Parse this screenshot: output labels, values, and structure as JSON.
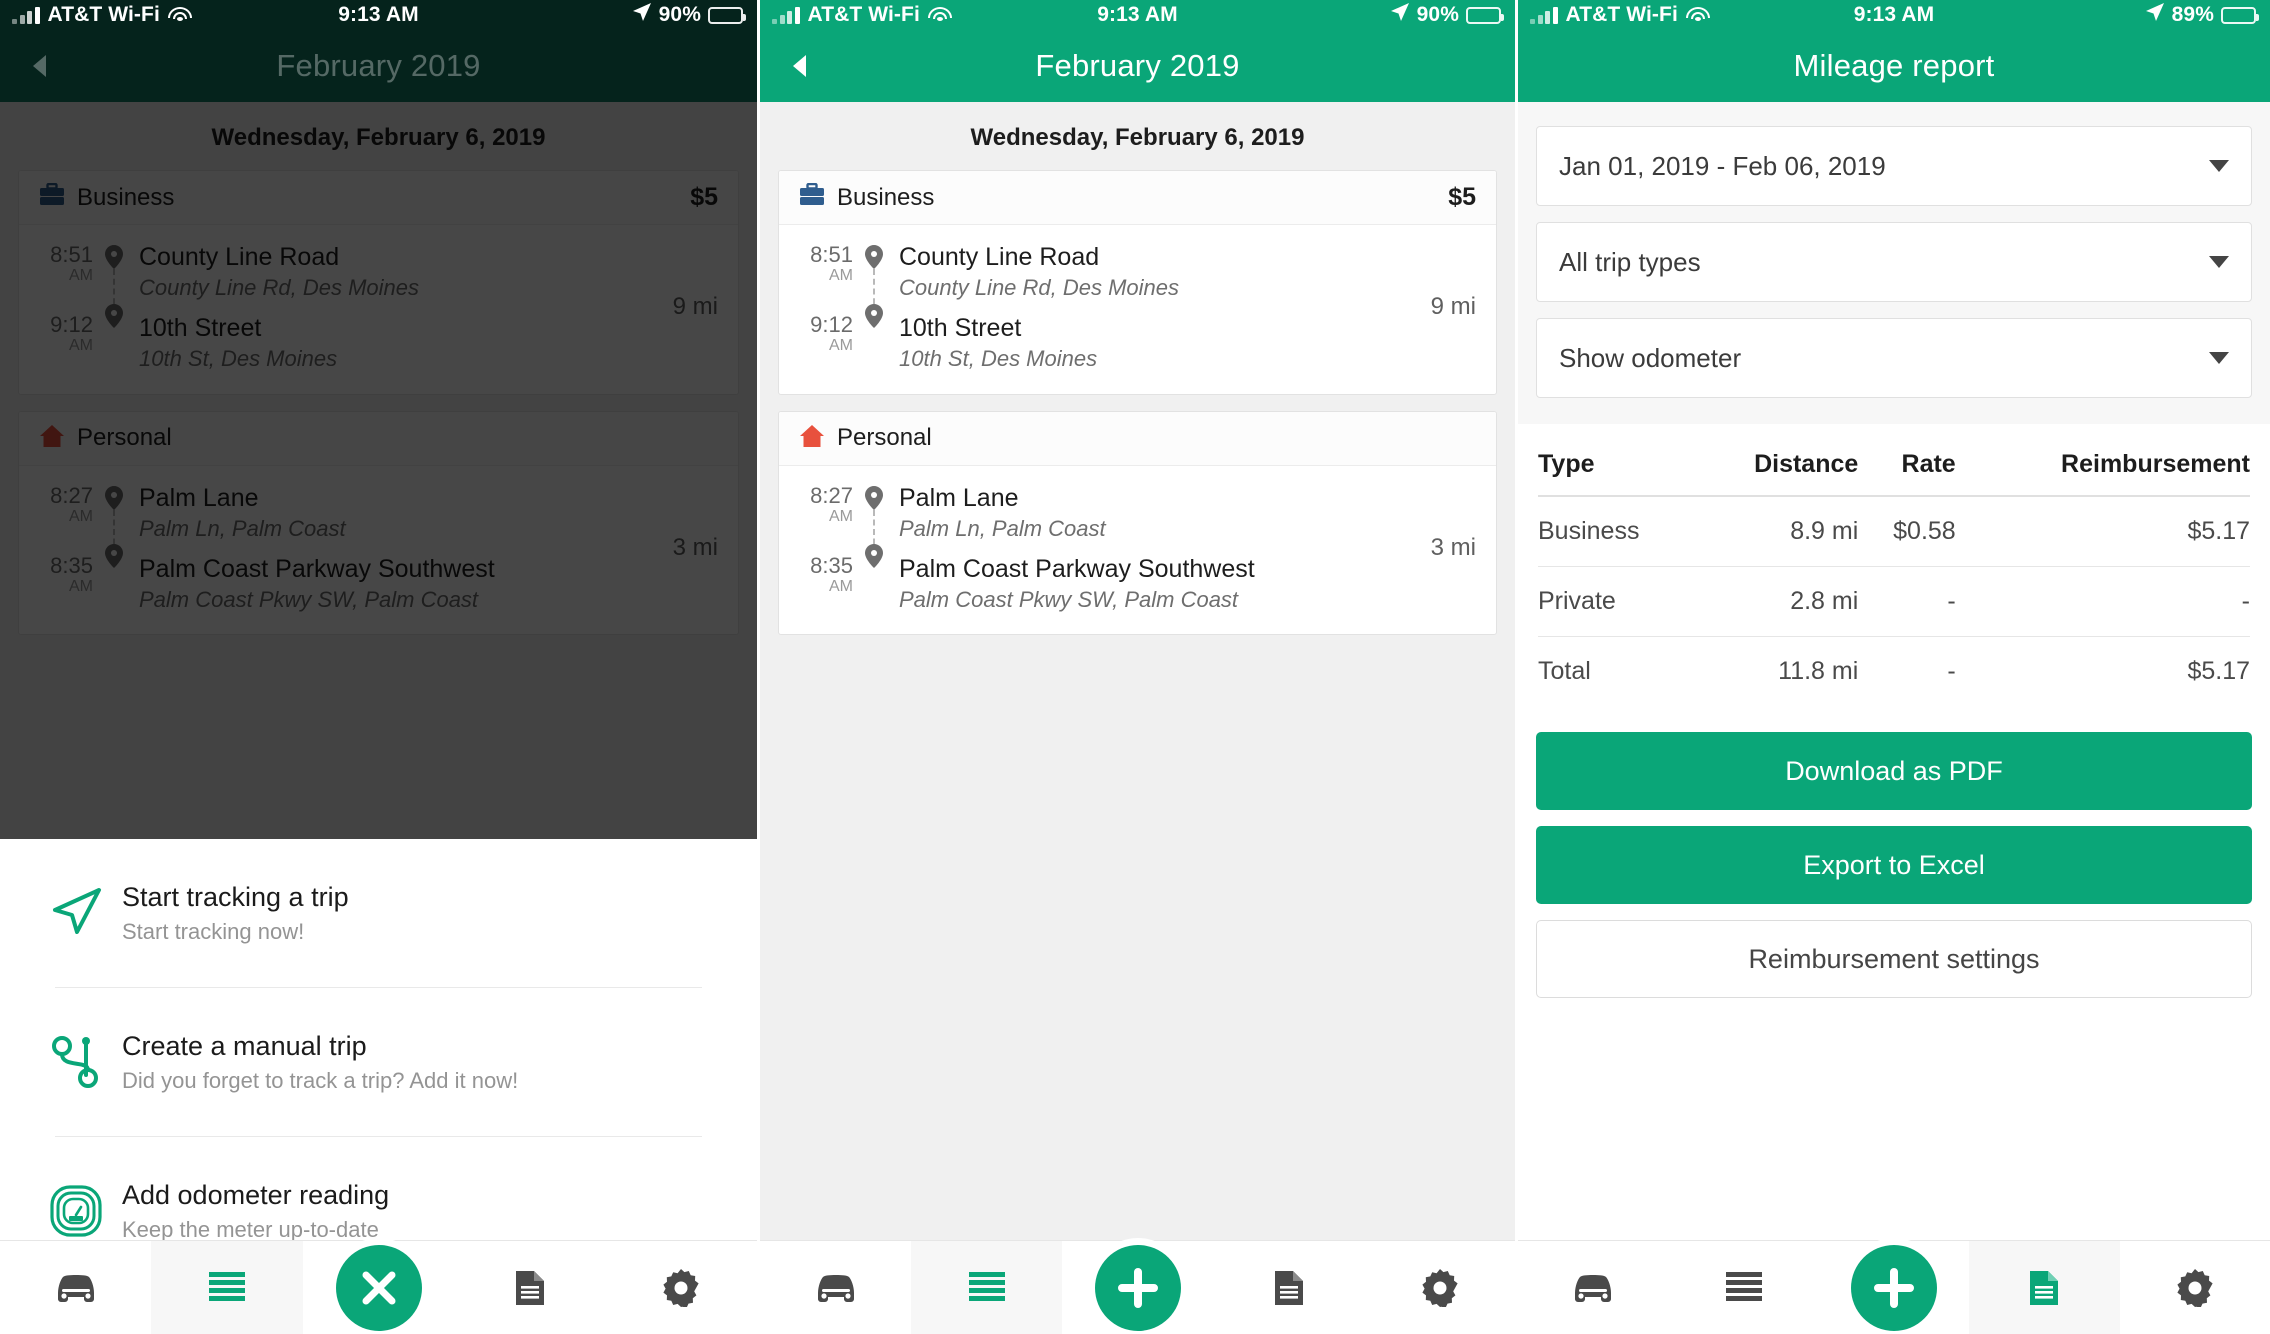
{
  "theme": {
    "brand": "#0aa678",
    "dim_overlay": "rgba(0,0,0,0.72)",
    "business_icon_color": "#2f5d8e",
    "personal_icon_color": "#e8513d"
  },
  "screens": [
    {
      "id": "trips-with-action-sheet",
      "status": {
        "carrier": "AT&T Wi-Fi",
        "time": "9:13 AM",
        "battery_pct": "90%"
      },
      "nav": {
        "title": "February 2019",
        "back": "back-arrow"
      },
      "day_label": "Wednesday, February 6, 2019",
      "cards": [
        {
          "category": "Business",
          "icon": "briefcase-icon",
          "amount": "$5",
          "distance": "9 mi",
          "legs": [
            {
              "time": "8:51",
              "ampm": "AM",
              "name": "County Line Road",
              "address": "County Line Rd, Des Moines"
            },
            {
              "time": "9:12",
              "ampm": "AM",
              "name": "10th Street",
              "address": "10th St, Des Moines"
            }
          ]
        },
        {
          "category": "Personal",
          "icon": "home-icon",
          "amount": "",
          "distance": "3 mi",
          "legs": [
            {
              "time": "8:27",
              "ampm": "AM",
              "name": "Palm Lane",
              "address": "Palm Ln, Palm Coast"
            },
            {
              "time": "8:35",
              "ampm": "AM",
              "name": "Palm Coast Parkway Southwest",
              "address": "Palm Coast Pkwy SW, Palm Coast"
            }
          ]
        }
      ],
      "action_sheet": [
        {
          "icon": "navigation-arrow-icon",
          "title": "Start tracking a trip",
          "subtitle": "Start tracking now!"
        },
        {
          "icon": "route-icon",
          "title": "Create a manual trip",
          "subtitle": "Did you forget to track a trip? Add it now!"
        },
        {
          "icon": "odometer-icon",
          "title": "Add odometer reading",
          "subtitle": "Keep the meter up-to-date"
        }
      ],
      "tabs": [
        {
          "icon": "car-icon",
          "active": false
        },
        {
          "icon": "list-icon",
          "active": true
        },
        {
          "icon": "close-icon",
          "fab": true
        },
        {
          "icon": "document-icon",
          "active": false
        },
        {
          "icon": "gear-icon",
          "active": false
        }
      ]
    },
    {
      "id": "trips-list",
      "status": {
        "carrier": "AT&T Wi-Fi",
        "time": "9:13 AM",
        "battery_pct": "90%"
      },
      "nav": {
        "title": "February 2019",
        "back": "back-arrow"
      },
      "day_label": "Wednesday, February 6, 2019",
      "cards": [
        {
          "category": "Business",
          "icon": "briefcase-icon",
          "amount": "$5",
          "distance": "9 mi",
          "legs": [
            {
              "time": "8:51",
              "ampm": "AM",
              "name": "County Line Road",
              "address": "County Line Rd, Des Moines"
            },
            {
              "time": "9:12",
              "ampm": "AM",
              "name": "10th Street",
              "address": "10th St, Des Moines"
            }
          ]
        },
        {
          "category": "Personal",
          "icon": "home-icon",
          "amount": "",
          "distance": "3 mi",
          "legs": [
            {
              "time": "8:27",
              "ampm": "AM",
              "name": "Palm Lane",
              "address": "Palm Ln, Palm Coast"
            },
            {
              "time": "8:35",
              "ampm": "AM",
              "name": "Palm Coast Parkway Southwest",
              "address": "Palm Coast Pkwy SW, Palm Coast"
            }
          ]
        }
      ],
      "tabs": [
        {
          "icon": "car-icon",
          "active": false
        },
        {
          "icon": "list-icon",
          "active": true
        },
        {
          "icon": "plus-icon",
          "fab": true
        },
        {
          "icon": "document-icon",
          "active": false
        },
        {
          "icon": "gear-icon",
          "active": false
        }
      ]
    },
    {
      "id": "mileage-report",
      "status": {
        "carrier": "AT&T Wi-Fi",
        "time": "9:13 AM",
        "battery_pct": "89%"
      },
      "nav": {
        "title": "Mileage report",
        "back": ""
      },
      "filters": [
        {
          "name": "date-range",
          "value": "Jan 01, 2019 - Feb 06, 2019"
        },
        {
          "name": "trip-type",
          "value": "All trip types"
        },
        {
          "name": "odometer",
          "value": "Show odometer"
        }
      ],
      "report": {
        "columns": [
          "Type",
          "Distance",
          "Rate",
          "Reimbursement"
        ],
        "rows": [
          [
            "Business",
            "8.9 mi",
            "$0.58",
            "$5.17"
          ],
          [
            "Private",
            "2.8 mi",
            "-",
            "-"
          ],
          [
            "Total",
            "11.8 mi",
            "-",
            "$5.17"
          ]
        ]
      },
      "buttons": [
        {
          "label": "Download as PDF",
          "style": "primary"
        },
        {
          "label": "Export to Excel",
          "style": "primary"
        },
        {
          "label": "Reimbursement settings",
          "style": "ghost"
        }
      ],
      "tabs": [
        {
          "icon": "car-icon",
          "active": false
        },
        {
          "icon": "list-icon",
          "active": false
        },
        {
          "icon": "plus-icon",
          "fab": true
        },
        {
          "icon": "document-icon",
          "active": true
        },
        {
          "icon": "gear-icon",
          "active": false
        }
      ]
    }
  ]
}
